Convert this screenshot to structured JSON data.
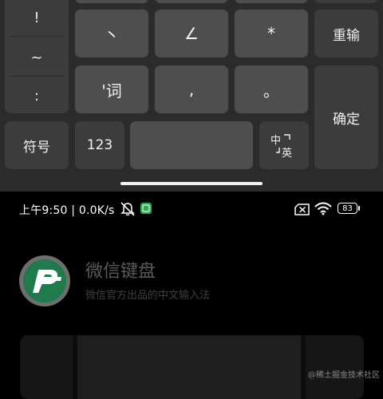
{
  "keyboard": {
    "symbols": [
      "!",
      "~",
      ":"
    ],
    "row1": [
      "丶",
      "∠",
      "*"
    ],
    "row2": [
      "'词",
      ",",
      "。"
    ],
    "reenter_label": "重输",
    "confirm_label": "确定",
    "symbol_key_label": "符号",
    "number_key_label": "123",
    "lang_zh": "中",
    "lang_en": "英"
  },
  "status_bar": {
    "time_text": "上午9:50 | 0.0K/s",
    "battery_level": "83"
  },
  "app": {
    "title": "微信键盘",
    "subtitle": "微信官方出品的中文输入法"
  },
  "watermark": "@稀土掘金技术社区"
}
